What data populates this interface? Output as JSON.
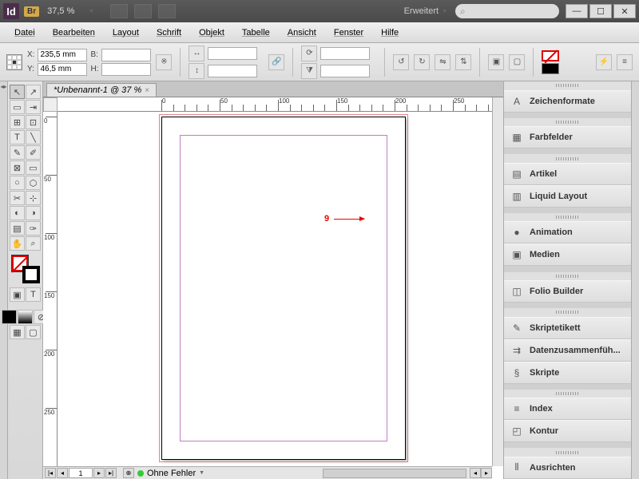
{
  "app": {
    "name": "Id",
    "bridge": "Br",
    "zoom": "37,5 %",
    "workspace": "Erweitert"
  },
  "window_buttons": {
    "min": "—",
    "max": "☐",
    "close": "✕"
  },
  "menu": [
    "Datei",
    "Bearbeiten",
    "Layout",
    "Schrift",
    "Objekt",
    "Tabelle",
    "Ansicht",
    "Fenster",
    "Hilfe"
  ],
  "control": {
    "x_label": "X:",
    "x_val": "235,5 mm",
    "y_label": "Y:",
    "y_val": "46,5 mm",
    "w_label": "B:",
    "w_val": "",
    "h_label": "H:",
    "h_val": ""
  },
  "tab": {
    "title": "*Unbenannt-1 @ 37 %"
  },
  "ruler_h": [
    {
      "pos": 0,
      "label": "0"
    },
    {
      "pos": 50,
      "label": "50"
    },
    {
      "pos": 100,
      "label": "100"
    },
    {
      "pos": 150,
      "label": "150"
    },
    {
      "pos": 200,
      "label": "200"
    },
    {
      "pos": 250,
      "label": "250"
    }
  ],
  "ruler_v": [
    {
      "pos": 0,
      "label": "0"
    },
    {
      "pos": 50,
      "label": "50"
    },
    {
      "pos": 100,
      "label": "100"
    },
    {
      "pos": 150,
      "label": "150"
    },
    {
      "pos": 200,
      "label": "200"
    },
    {
      "pos": 250,
      "label": "250"
    }
  ],
  "annotation": {
    "text": "9"
  },
  "status": {
    "page": "1",
    "preflight": "Ohne Fehler"
  },
  "panels": [
    {
      "icon": "A",
      "label": "Zeichenformate"
    },
    {
      "gap": true
    },
    {
      "icon": "▦",
      "label": "Farbfelder"
    },
    {
      "gap": true
    },
    {
      "icon": "▤",
      "label": "Artikel"
    },
    {
      "icon": "▥",
      "label": "Liquid Layout"
    },
    {
      "gap": true
    },
    {
      "icon": "●",
      "label": "Animation"
    },
    {
      "icon": "▣",
      "label": "Medien"
    },
    {
      "gap": true
    },
    {
      "icon": "◫",
      "label": "Folio Builder"
    },
    {
      "gap": true
    },
    {
      "icon": "✎",
      "label": "Skriptetikett"
    },
    {
      "icon": "⇉",
      "label": "Datenzusammenfüh..."
    },
    {
      "icon": "§",
      "label": "Skripte"
    },
    {
      "gap": true
    },
    {
      "icon": "≡",
      "label": "Index"
    },
    {
      "icon": "◰",
      "label": "Kontur"
    },
    {
      "gap": true
    },
    {
      "icon": "⫴",
      "label": "Ausrichten"
    }
  ]
}
